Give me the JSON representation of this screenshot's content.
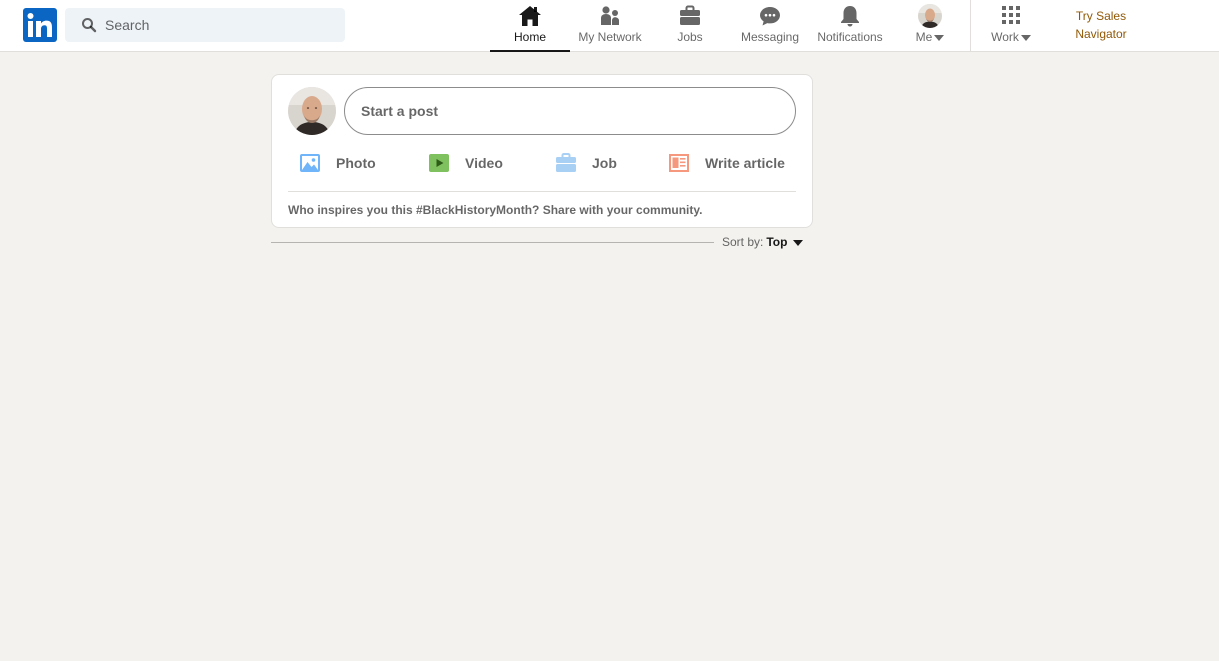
{
  "nav": {
    "search_placeholder": "Search",
    "items": [
      {
        "label": "Home",
        "icon": "home-icon"
      },
      {
        "label": "My Network",
        "icon": "network-icon"
      },
      {
        "label": "Jobs",
        "icon": "briefcase-icon"
      },
      {
        "label": "Messaging",
        "icon": "messaging-icon"
      },
      {
        "label": "Notifications",
        "icon": "bell-icon"
      },
      {
        "label": "Me",
        "icon": "avatar"
      },
      {
        "label": "Work",
        "icon": "grid-icon"
      }
    ],
    "sales_navigator": "Try Sales Navigator"
  },
  "share": {
    "start_post": "Start a post",
    "actions": [
      {
        "label": "Photo",
        "icon": "photo-icon",
        "color": "#70b5f9"
      },
      {
        "label": "Video",
        "icon": "video-icon",
        "color": "#7fc15e"
      },
      {
        "label": "Job",
        "icon": "job-icon",
        "color": "#a8d0f5"
      },
      {
        "label": "Write article",
        "icon": "article-icon",
        "color": "#f5987e"
      }
    ],
    "prompt": "Who inspires you this #BlackHistoryMonth? Share with your community."
  },
  "sort": {
    "label": "Sort by:",
    "value": "Top"
  },
  "colors": {
    "brand": "#0a66c2",
    "background": "#f3f2ef",
    "premium": "#915907"
  }
}
